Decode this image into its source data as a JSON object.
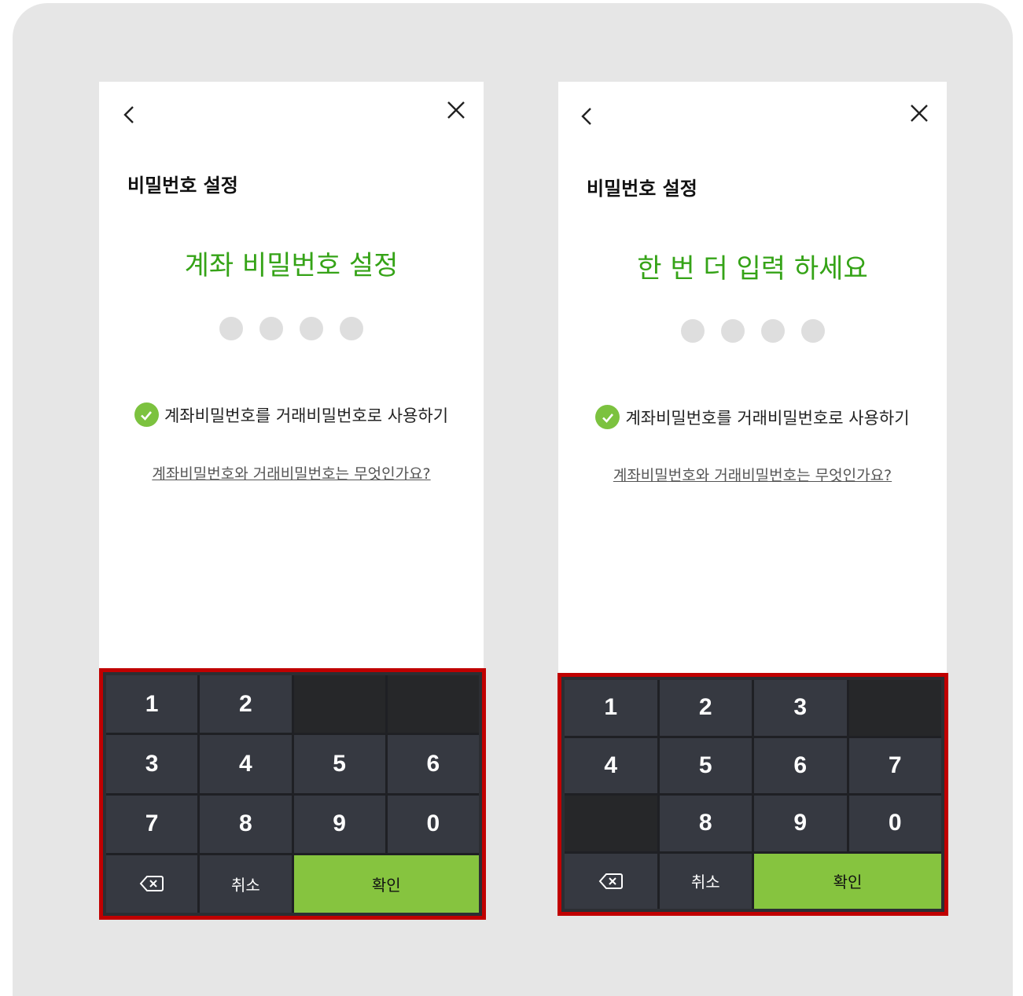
{
  "screens": [
    {
      "title": "비밀번호 설정",
      "prompt": "계좌 비밀번호 설정",
      "pin_length": 4,
      "option_label": "계좌비밀번호를 거래비밀번호로 사용하기",
      "option_checked": true,
      "help_link": "계좌비밀번호와 거래비밀번호는 무엇인가요?",
      "keypad": {
        "rows": [
          [
            "1",
            "2",
            "",
            ""
          ],
          [
            "3",
            "4",
            "5",
            "6"
          ],
          [
            "7",
            "8",
            "9",
            "0"
          ]
        ],
        "backspace_icon": "backspace-icon",
        "cancel_label": "취소",
        "confirm_label": "확인"
      }
    },
    {
      "title": "비밀번호 설정",
      "prompt": "한 번 더 입력 하세요",
      "pin_length": 4,
      "option_label": "계좌비밀번호를 거래비밀번호로 사용하기",
      "option_checked": true,
      "help_link": "계좌비밀번호와 거래비밀번호는 무엇인가요?",
      "keypad": {
        "rows": [
          [
            "1",
            "2",
            "3",
            ""
          ],
          [
            "4",
            "5",
            "6",
            "7"
          ],
          [
            "",
            "8",
            "9",
            "0"
          ]
        ],
        "backspace_icon": "backspace-icon",
        "cancel_label": "취소",
        "confirm_label": "확인"
      }
    }
  ],
  "colors": {
    "accent_green": "#35a317",
    "confirm_green": "#86c43f",
    "highlight_red": "#c00000",
    "keypad_dark": "#363941"
  }
}
